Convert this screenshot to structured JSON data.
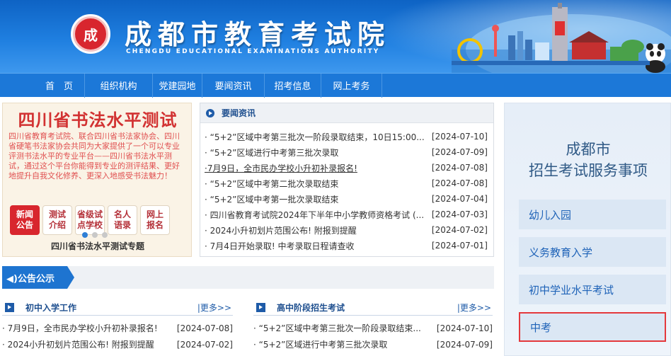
{
  "header": {
    "logo_char": "成",
    "title": "成都市教育考试院",
    "subtitle": "CHENGDU EDUCATIONAL EXAMINATIONS AUTHORITY"
  },
  "nav": {
    "items": [
      "首　页",
      "组织机构",
      "党建园地",
      "要闻资讯",
      "招考信息",
      "网上考务"
    ]
  },
  "banner": {
    "title": "四川省书法水平测试",
    "description": "四川省教育考试院、联合四川省书法家协会、四川省硬笔书法家协会共同为大家提供了一个可以专业评测书法水平的专业平台——四川省书法水平测试，通过这个平台你能得到专业的测评结果、更好地提升自我文化修养、更深入地感受书法魅力！",
    "buttons": [
      {
        "line1": "新闻",
        "line2": "公告"
      },
      {
        "line1": "测试",
        "line2": "介绍"
      },
      {
        "line1": "省级试",
        "line2": "点学校"
      },
      {
        "line1": "名人",
        "line2": "语录"
      },
      {
        "line1": "网上",
        "line2": "报名"
      }
    ],
    "caption": "四川省书法水平测试专题"
  },
  "news": {
    "heading": "要闻资讯",
    "items": [
      {
        "text": "· “5+2”区域中考第三批次一阶段录取结束，10日15:00...",
        "date": "[2024-07-10]"
      },
      {
        "text": "· “5+2”区域进行中考第三批次录取",
        "date": "[2024-07-09]"
      },
      {
        "text": "·7月9日，全市民办学校小升初补录报名!",
        "date": "[2024-07-08]"
      },
      {
        "text": "· “5+2”区域中考第二批次录取结束",
        "date": "[2024-07-08]"
      },
      {
        "text": "· “5+2”区域中考第一批次录取结束",
        "date": "[2024-07-04]"
      },
      {
        "text": "· 四川省教育考试院2024年下半年中小学教师资格考试 (...",
        "date": "[2024-07-03]"
      },
      {
        "text": "· 2024小升初划片范围公布! 附报到提醒",
        "date": "[2024-07-02]"
      },
      {
        "text": "· 7月4日开始录取! 中考录取日程请查收",
        "date": "[2024-07-01]"
      }
    ]
  },
  "notice": {
    "label": "◀)公告公示"
  },
  "column_left": {
    "heading": "初中入学工作",
    "more": "|更多>>",
    "items": [
      {
        "text": "· 7月9日，全市民办学校小升初补录报名!",
        "date": "[2024-07-08]"
      },
      {
        "text": "· 2024小升初划片范围公布! 附报到提醒",
        "date": "[2024-07-02]"
      }
    ]
  },
  "column_right": {
    "heading": "高中阶段招生考试",
    "more": "|更多>>",
    "items": [
      {
        "text": "· “5+2”区域中考第三批次一阶段录取结束...",
        "date": "[2024-07-10]"
      },
      {
        "text": "· “5+2”区域进行中考第三批次录取",
        "date": "[2024-07-09]"
      }
    ]
  },
  "service": {
    "title_line1": "成都市",
    "title_line2": "招生考试服务事项",
    "items": [
      "幼儿入园",
      "义务教育入学",
      "初中学业水平考试",
      "中考"
    ],
    "highlight_color": "#e4393c"
  }
}
